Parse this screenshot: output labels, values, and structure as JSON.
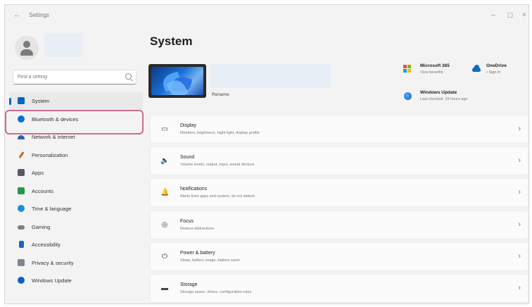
{
  "window": {
    "title": "Settings",
    "back_glyph": "←",
    "minimize_glyph": "–",
    "maximize_glyph": "☐",
    "close_glyph": "×"
  },
  "sidebar": {
    "search_placeholder": "Find a setting",
    "items": [
      {
        "label": "System",
        "icon": "laptop-icon",
        "color": "#0067c0",
        "selected": true
      },
      {
        "label": "Bluetooth & devices",
        "icon": "bluetooth-icon",
        "color": "#0a6fd6",
        "selected": false
      },
      {
        "label": "Network & internet",
        "icon": "network-icon",
        "color": "#2b63b7",
        "selected": false
      },
      {
        "label": "Personalization",
        "icon": "brush-icon",
        "color": "#c46b2d",
        "selected": false
      },
      {
        "label": "Apps",
        "icon": "apps-icon",
        "color": "#555a66",
        "selected": false
      },
      {
        "label": "Accounts",
        "icon": "accounts-icon",
        "color": "#1f9a4d",
        "selected": false
      },
      {
        "label": "Time & language",
        "icon": "globe-clock-icon",
        "color": "#1a8fe0",
        "selected": false
      },
      {
        "label": "Gaming",
        "icon": "gamepad-icon",
        "color": "#7d7d7d",
        "selected": false
      },
      {
        "label": "Accessibility",
        "icon": "accessibility-icon",
        "color": "#1667c7",
        "selected": false
      },
      {
        "label": "Privacy & security",
        "icon": "shield-icon",
        "color": "#7d8590",
        "selected": false
      },
      {
        "label": "Windows Update",
        "icon": "update-icon",
        "color": "#0a64c8",
        "selected": false
      }
    ]
  },
  "main": {
    "title": "System",
    "device": {
      "rename_label": "Rename"
    },
    "quick_tiles": {
      "ms365": {
        "title": "Microsoft 365",
        "subtitle": "View benefits"
      },
      "onedrive": {
        "title": "OneDrive",
        "subtitle": "• Sign in"
      },
      "update": {
        "title": "Windows Update",
        "subtitle": "Last checked: 19 hours ago"
      }
    },
    "settings": [
      {
        "title": "Display",
        "subtitle": "Monitors, brightness, night light, display profile",
        "icon": "display-icon",
        "glyph": "▭"
      },
      {
        "title": "Sound",
        "subtitle": "Volume levels, output, input, sound devices",
        "icon": "speaker-icon",
        "glyph": "🔈"
      },
      {
        "title": "Notifications",
        "subtitle": "Alerts from apps and system, do not disturb",
        "icon": "bell-icon",
        "glyph": "🔔"
      },
      {
        "title": "Focus",
        "subtitle": "Reduce distractions",
        "icon": "focus-icon",
        "glyph": "◎"
      },
      {
        "title": "Power & battery",
        "subtitle": "Sleep, battery usage, battery saver",
        "icon": "power-icon",
        "glyph": "⏻"
      },
      {
        "title": "Storage",
        "subtitle": "Storage space, drives, configuration rules",
        "icon": "storage-icon",
        "glyph": "▬"
      }
    ],
    "chevron_glyph": "›"
  }
}
